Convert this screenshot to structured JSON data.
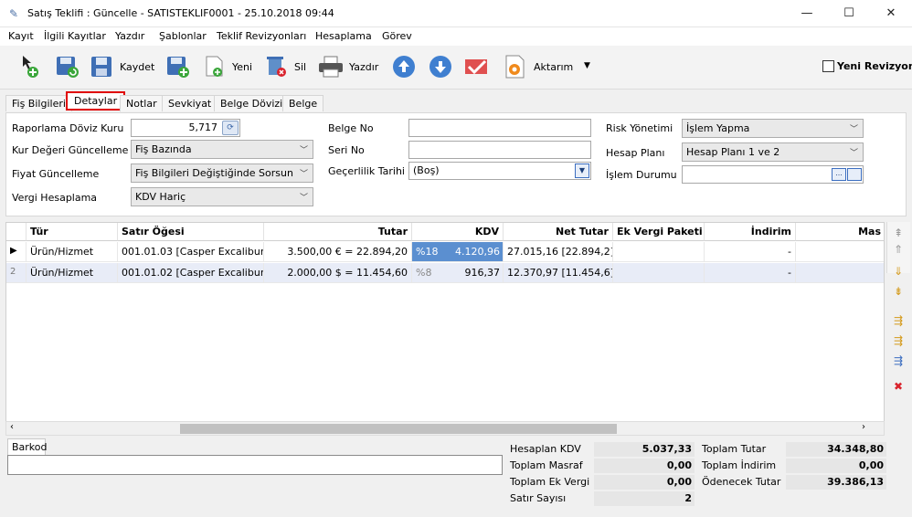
{
  "window": {
    "title": "Satış Teklifi : Güncelle - SATISTEKLIF0001 - 25.10.2018 09:44"
  },
  "menu": [
    "Kayıt",
    "İlgili Kayıtlar",
    "Yazdır",
    "Şablonlar",
    "Teklif Revizyonları",
    "Hesaplama",
    "Görev"
  ],
  "toolbar": {
    "save_label": "Kaydet",
    "new_label": "Yeni",
    "delete_label": "Sil",
    "print_label": "Yazdır",
    "export_label": "Aktarım",
    "new_revision_label": "Yeni Revizyon"
  },
  "tabs": [
    "Fiş Bilgileri",
    "Detaylar",
    "Notlar",
    "Sevkiyat",
    "Belge Dövizi",
    "Belge"
  ],
  "form": {
    "report_currency_label": "Raporlama Döviz Kuru",
    "report_currency_value": "5,717",
    "rate_update_label": "Kur Değeri Güncelleme",
    "rate_update_value": "Fiş Bazında",
    "price_update_label": "Fiyat Güncelleme",
    "price_update_value": "Fiş Bilgileri Değiştiğinde Sorsun",
    "tax_calc_label": "Vergi Hesaplama",
    "tax_calc_value": "KDV Hariç",
    "doc_no_label": "Belge No",
    "doc_no_value": "",
    "serial_no_label": "Seri No",
    "serial_no_value": "",
    "validity_label": "Geçerlilik Tarihi",
    "validity_value": "(Boş)",
    "risk_label": "Risk Yönetimi",
    "risk_value": "İşlem Yapma",
    "account_plan_label": "Hesap Planı",
    "account_plan_value": "Hesap Planı 1 ve 2",
    "status_label": "İşlem Durumu",
    "status_value": ""
  },
  "grid": {
    "headers": [
      "Tür",
      "Satır Öğesi",
      "Tutar",
      "KDV",
      "Net Tutar",
      "Ek Vergi Paketi",
      "İndirim",
      "Mas"
    ],
    "rows": [
      {
        "indicator": "▶",
        "type": "Ürün/Hizmet",
        "item": "001.01.03 [Casper Excalibur ...",
        "amount": "3.500,00 € = 22.894,20",
        "vat_rate": "%18",
        "vat": "4.120,96",
        "net": "27.015,16 [22.894,2]",
        "extra_tax": "",
        "discount": "-"
      },
      {
        "indicator": "2",
        "type": "Ürün/Hizmet",
        "item": "001.01.02 [Casper Excalibur ...",
        "amount": "2.000,00 $ = 11.454,60",
        "vat_rate": "%8",
        "vat": "916,37",
        "net": "12.370,97 [11.454,6]",
        "extra_tax": "",
        "discount": "-"
      }
    ]
  },
  "barcode": {
    "label": "Barkod",
    "value": ""
  },
  "totals": {
    "calc_vat_label": "Hesaplan KDV",
    "calc_vat": "5.037,33",
    "total_expense_label": "Toplam Masraf",
    "total_expense": "0,00",
    "total_extra_tax_label": "Toplam Ek Vergi",
    "total_extra_tax": "0,00",
    "row_count_label": "Satır Sayısı",
    "row_count": "2",
    "total_amount_label": "Toplam Tutar",
    "total_amount": "34.348,80",
    "total_discount_label": "Toplam İndirim",
    "total_discount": "0,00",
    "payable_label": "Ödenecek Tutar",
    "payable": "39.386,13"
  },
  "colors": {
    "accent_red": "#e00000",
    "selected_blue": "#5b8fd0",
    "row_alt": "#e8ecf7"
  }
}
